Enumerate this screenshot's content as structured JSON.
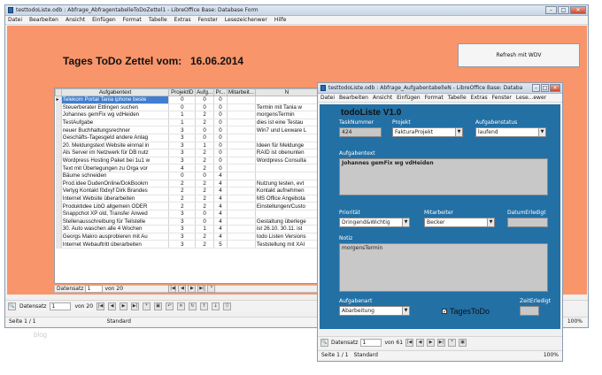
{
  "main": {
    "title": "testtodoListe.odb : Abfrage_AbfragentabelleToDoZettel1 - LibreOffice Base: Database Form",
    "menu": [
      "Datei",
      "Bearbeiten",
      "Ansicht",
      "Einfügen",
      "Format",
      "Tabelle",
      "Extras",
      "Fenster",
      "Lesezeichenwer",
      "Hilfe"
    ],
    "heading": "Tages ToDo Zettel vom:",
    "date": "16.06.2014",
    "refresh_btn": "Refresh mit WDV",
    "grid": {
      "headers": [
        "Aufgabentext",
        "ProjektID",
        "Aufg...",
        "Pr...",
        "Mitarbeit...",
        "N"
      ],
      "rows": [
        [
          "Telekom Portal Tania iphone beste",
          "0",
          "0",
          "0",
          ""
        ],
        [
          "Steuerberater Ettlingen suchen",
          "0",
          "0",
          "0",
          "Termin mit Tania w"
        ],
        [
          "Johannes gemFix wg vdHeiden",
          "1",
          "2",
          "0",
          "morgensTermin"
        ],
        [
          "TestAufgabe",
          "1",
          "2",
          "0",
          "dies ist eine Testau"
        ],
        [
          "neuer Buchhaltungsrechner",
          "3",
          "0",
          "0",
          "Win7 und Lexware L"
        ],
        [
          "Geschäfts-Tagesgeld andere Anlag",
          "3",
          "0",
          "0",
          ""
        ],
        [
          "20. Meldungstext Website einmal in",
          "3",
          "1",
          "0",
          "Ideen für Meldunge"
        ],
        [
          "Als Server im Netzwerk für DB nutz",
          "3",
          "2",
          "0",
          "RAID ist obenunten"
        ],
        [
          "Wordpress Hosting Paket bei 1u1 w",
          "3",
          "2",
          "0",
          "Wordpress Consulta"
        ],
        [
          "Text mit Überlegungen zu Orga vor",
          "4",
          "2",
          "0",
          ""
        ],
        [
          "Bäume schneiden",
          "0",
          "0",
          "4",
          ""
        ],
        [
          "Prod.idee DudenOnline/DokBookm",
          "2",
          "2",
          "4",
          "Nutzung testen, evt"
        ],
        [
          "Vertyg Kontakt födxyf Dirk Brandes",
          "2",
          "2",
          "4",
          "Kontakt aufnehmen"
        ],
        [
          "Internet Website überarbeiten",
          "2",
          "2",
          "4",
          "MS Office Angebota"
        ],
        [
          "Produktidee LibO allgemein ODER",
          "2",
          "2",
          "4",
          "Einstellungen/Custo"
        ],
        [
          "Snappchot XP old, Transfer Anwed",
          "3",
          "0",
          "4",
          ""
        ],
        [
          "Stellenausschreibung für Teilstelle",
          "3",
          "0",
          "4",
          "Gestaltung überlege"
        ],
        [
          "30. Auto waschen alle 4 Wochen",
          "3",
          "1",
          "4",
          "ist 26.10. 30.11. ist"
        ],
        [
          "Georgs Makro ausprobieren mit Au",
          "3",
          "2",
          "4",
          "todo Listen Versions"
        ],
        [
          "Internet Webauftritt überarbeiten",
          "3",
          "2",
          "5",
          "Teststellung mit XAI"
        ]
      ],
      "record_label": "Datensatz",
      "record_value": "1",
      "record_of": "von 20"
    },
    "toolbar": {
      "label": "Datensatz",
      "value": "1",
      "of": "von 20"
    },
    "status": {
      "page": "Seite 1 / 1",
      "mode": "Standard",
      "zoom": "100%"
    }
  },
  "popup": {
    "title": "testtodoListe.odb : Abfrage_AufgabentabelleN - LibreOffice Base: Databa",
    "menu": [
      "Datei",
      "Bearbeiten",
      "Ansicht",
      "Einfügen",
      "Format",
      "Tabelle",
      "Extras",
      "Fenster",
      "Lese...ewer"
    ],
    "heading": "todoListe V1.0",
    "labels": {
      "tasknum": "TaskNummer",
      "projekt": "Projekt",
      "aufgabenstatus": "Aufgabenstatus",
      "aufgabentext": "Aufgabentext",
      "prioritaet": "Priorität",
      "mitarbeiter": "Mitarbeiter",
      "datum_erledigt": "DatumErledigt",
      "notiz": "Notiz",
      "aufgabenart": "Aufgabenart",
      "zeit_erledigt": "ZeitErledigt",
      "tages_todo": "TagesToDo"
    },
    "values": {
      "tasknum": "424",
      "projekt": "FakturaProjekt",
      "aufgabenstatus": "laufend",
      "aufgabentext": "Johannes gemFix wg vdHeiden",
      "prioritaet": "Dringend&Wichtig",
      "mitarbeiter": "Becker",
      "datum_erledigt": "",
      "notiz": "morgensTermin",
      "aufgabenart": "Abarbeitung",
      "zeit_erledigt": ""
    },
    "toolbar": {
      "label": "Datensatz",
      "value": "1",
      "of": "von 61"
    },
    "status": {
      "page": "Seite 1 / 1",
      "mode": "Standard",
      "zoom": "100%"
    }
  },
  "watermark": "blog",
  "colors": {
    "form_bg": "#f8956b",
    "popup_bg": "#2370a5",
    "selected_row": "#3f7ed0"
  }
}
